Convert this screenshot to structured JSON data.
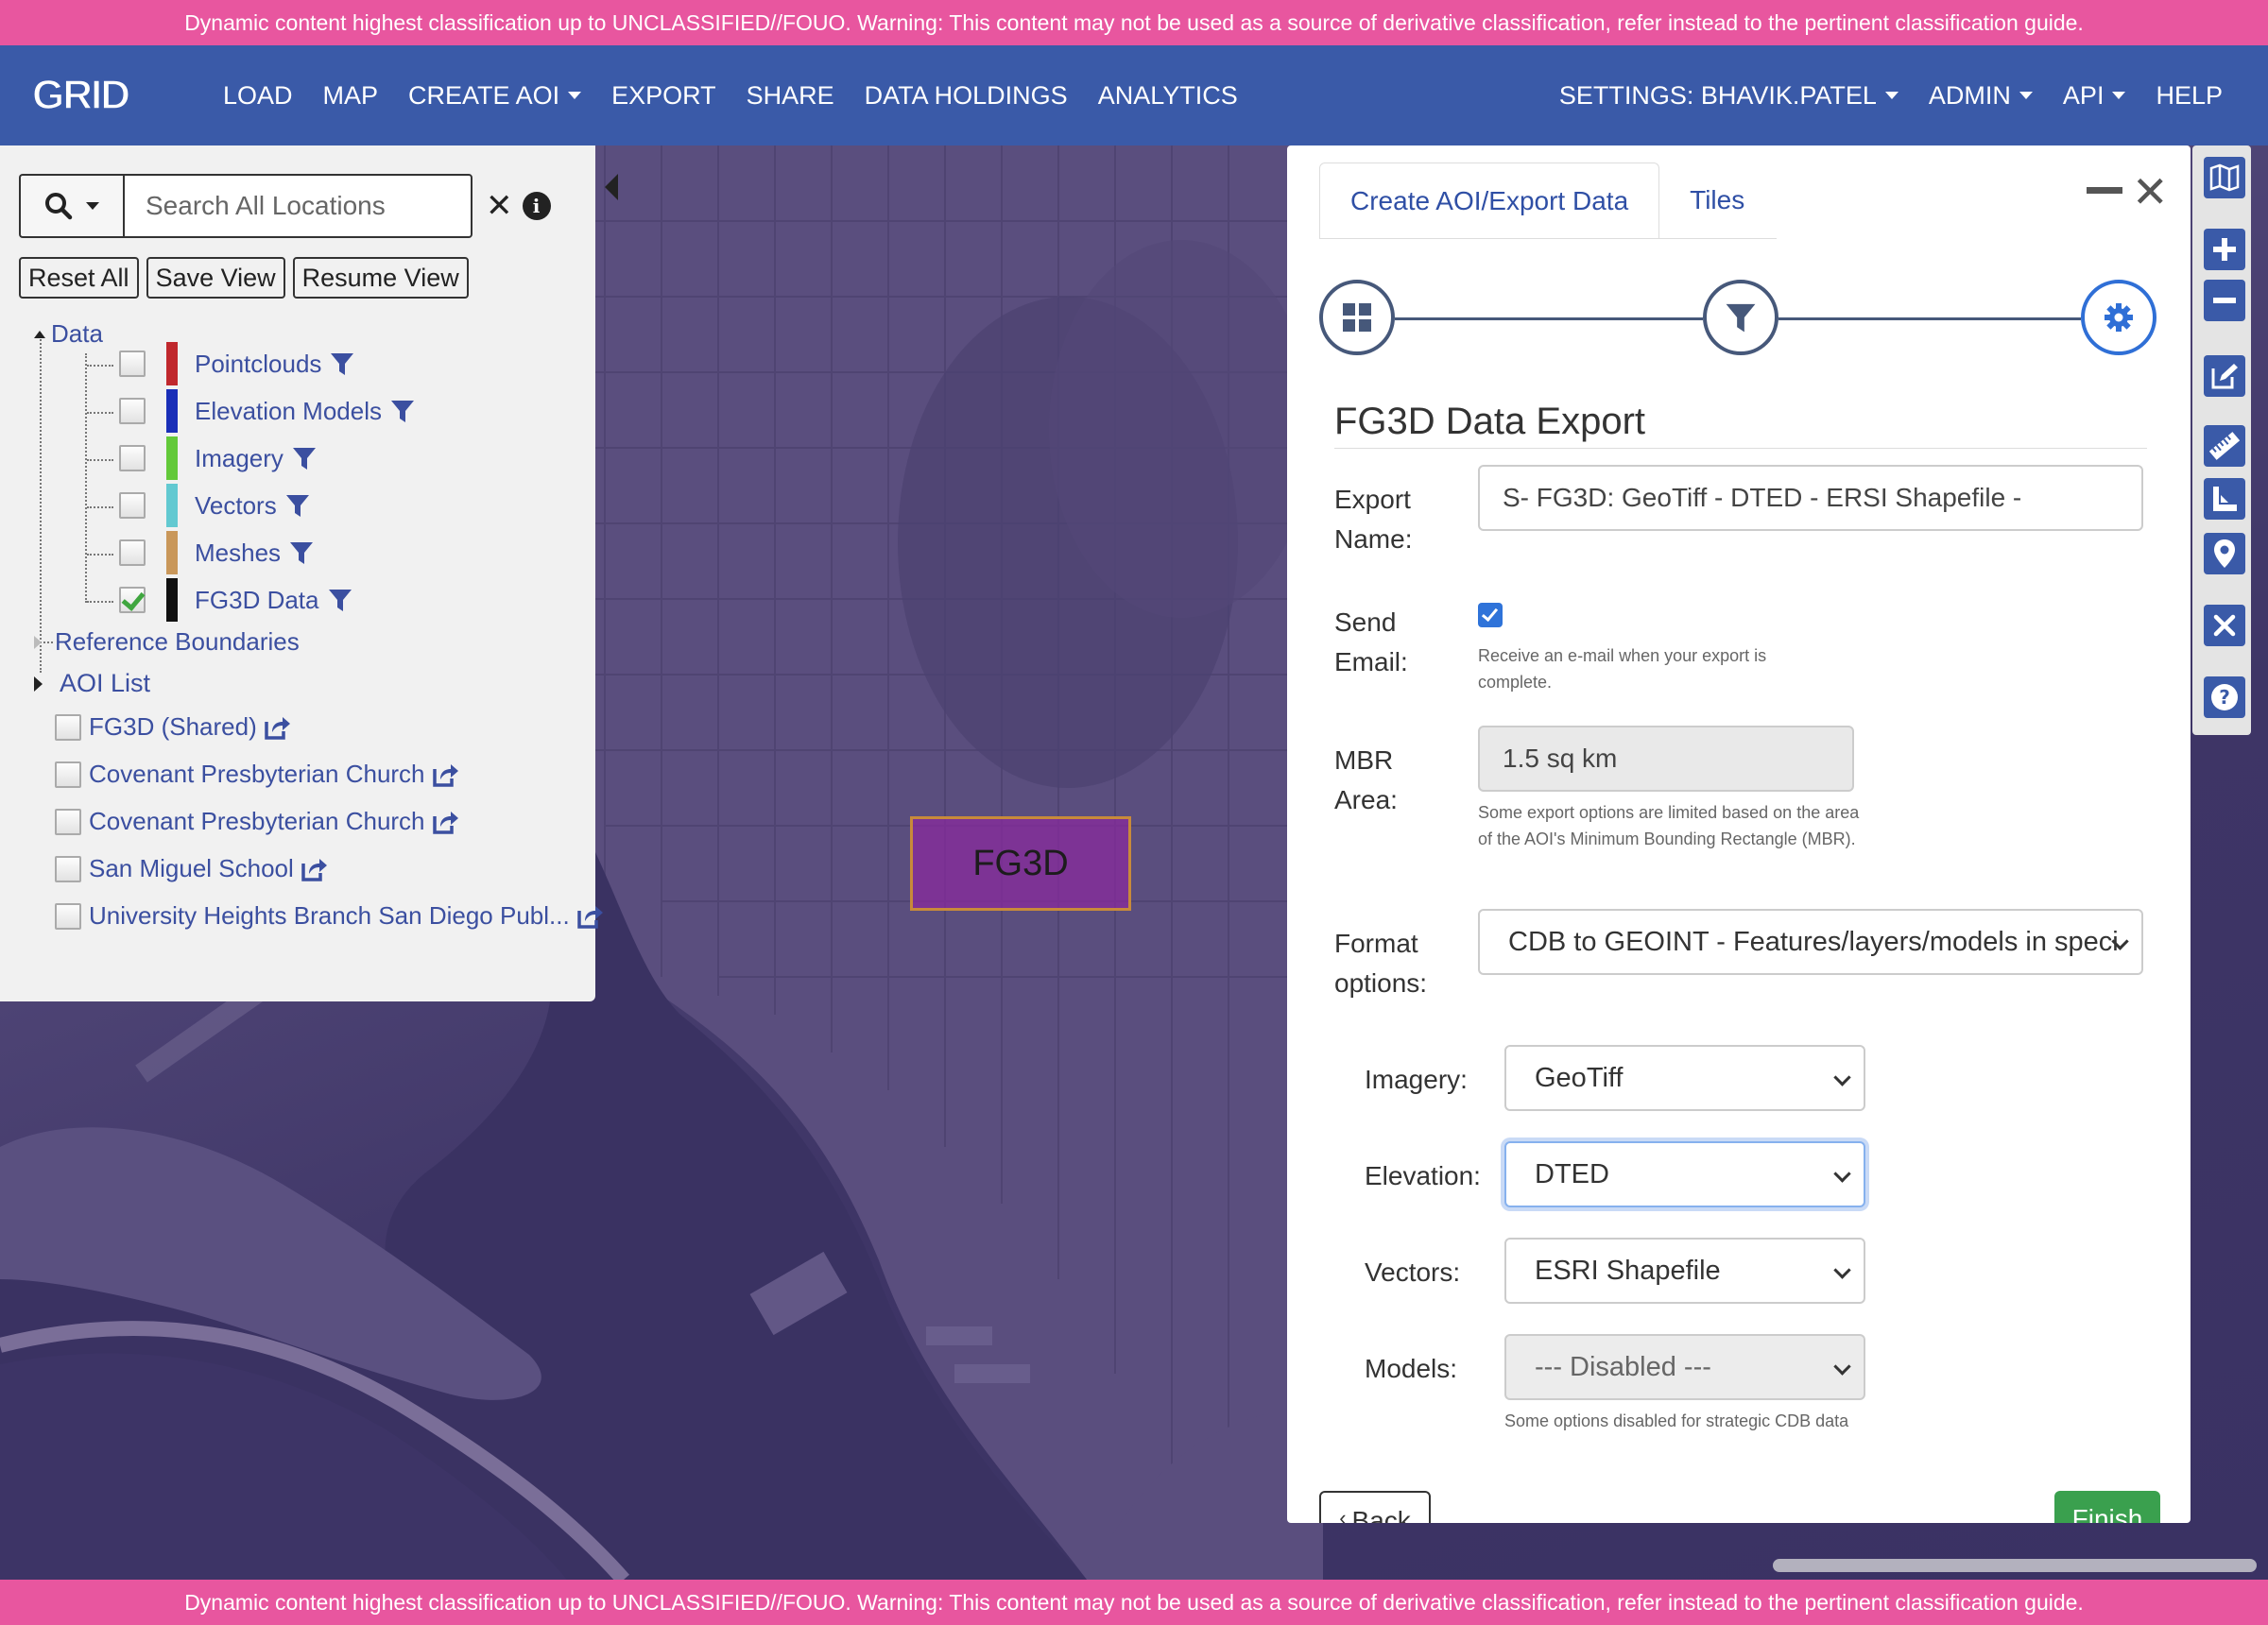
{
  "classification": {
    "text": "Dynamic content highest classification up to UNCLASSIFIED//FOUO. Warning: This content may not be used as a source of derivative classification, refer instead to the pertinent classification guide.",
    "color": "#e8569f"
  },
  "navbar": {
    "logo": "GRID",
    "left_items": [
      {
        "label": "LOAD",
        "dropdown": false
      },
      {
        "label": "MAP",
        "dropdown": false
      },
      {
        "label": "CREATE AOI",
        "dropdown": true
      },
      {
        "label": "EXPORT",
        "dropdown": false
      },
      {
        "label": "SHARE",
        "dropdown": false
      },
      {
        "label": "DATA HOLDINGS",
        "dropdown": false
      },
      {
        "label": "ANALYTICS",
        "dropdown": false
      }
    ],
    "right_items": [
      {
        "label": "SETTINGS: BHAVIK.PATEL",
        "dropdown": true
      },
      {
        "label": "ADMIN",
        "dropdown": true
      },
      {
        "label": "API",
        "dropdown": true
      },
      {
        "label": "HELP",
        "dropdown": false
      }
    ],
    "color": "#3a5aa8"
  },
  "left_panel": {
    "search_placeholder": "Search All Locations",
    "buttons": {
      "reset": "Reset All",
      "save_view": "Save View",
      "resume_view": "Resume View"
    },
    "data_root": "Data",
    "layers": [
      {
        "label": "Pointclouds",
        "color": "#c0282d",
        "checked": false
      },
      {
        "label": "Elevation Models",
        "color": "#1a2fb8",
        "checked": false
      },
      {
        "label": "Imagery",
        "color": "#63c93a",
        "checked": false
      },
      {
        "label": "Vectors",
        "color": "#62c9d1",
        "checked": false
      },
      {
        "label": "Meshes",
        "color": "#c9975a",
        "checked": false
      },
      {
        "label": "FG3D Data",
        "color": "#111111",
        "checked": true
      }
    ],
    "reference_boundaries": "Reference Boundaries",
    "aoi_list_label": "AOI List",
    "aoi_items": [
      "FG3D (Shared)",
      "Covenant Presbyterian Church",
      "Covenant Presbyterian Church",
      "San Miguel School",
      "University Heights Branch San Diego Publ..."
    ]
  },
  "map": {
    "aoi_label": "FG3D"
  },
  "export_panel": {
    "tabs": [
      "Create AOI/Export Data",
      "Tiles"
    ],
    "active_tab": 0,
    "wizard_steps": [
      "grid-icon",
      "filter-icon",
      "gear-icon"
    ],
    "active_step": 2,
    "title": "FG3D Data Export",
    "export_name_label": "Export Name:",
    "export_name_value": "S- FG3D: GeoTiff - DTED - ERSI Shapefile -",
    "send_email_label": "Send Email:",
    "send_email_checked": true,
    "send_email_help": "Receive an e-mail when your export is complete.",
    "mbr_label": "MBR Area:",
    "mbr_value": "1.5 sq km",
    "mbr_help": "Some export options are limited based on the area of the AOI's Minimum Bounding Rectangle (MBR).",
    "format_label": "Format options:",
    "format_value": "CDB to GEOINT - Features/layers/models in speci",
    "imagery_label": "Imagery:",
    "imagery_value": "GeoTiff",
    "elevation_label": "Elevation:",
    "elevation_value": "DTED",
    "vectors_label": "Vectors:",
    "vectors_value": "ESRI Shapefile",
    "models_label": "Models:",
    "models_value": "--- Disabled ---",
    "models_help": "Some options disabled for strategic CDB data",
    "back_label": "Back",
    "finish_label": "Finish"
  },
  "toolbar": {
    "tools": [
      "map-icon",
      "zoom-in-icon",
      "zoom-out-icon",
      "edit-icon",
      "ruler-icon",
      "area-measure-icon",
      "location-pin-icon",
      "clear-icon",
      "help-icon"
    ]
  }
}
